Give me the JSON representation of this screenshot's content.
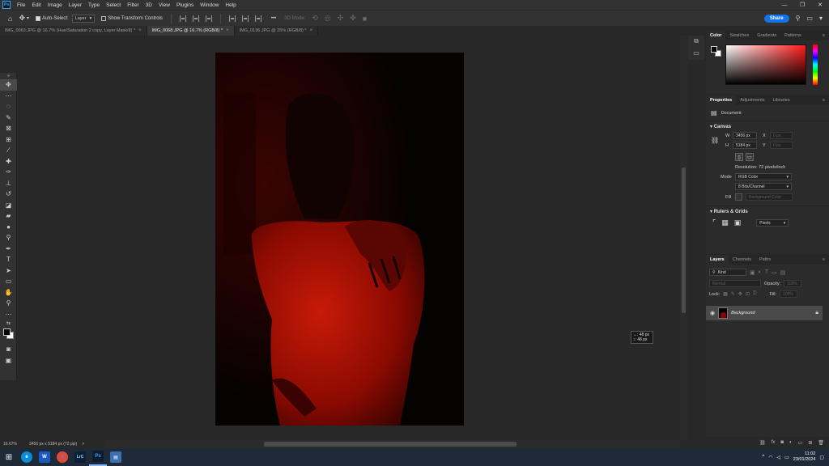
{
  "app": {
    "logo": "Ps"
  },
  "menu": [
    "File",
    "Edit",
    "Image",
    "Layer",
    "Type",
    "Select",
    "Filter",
    "3D",
    "View",
    "Plugins",
    "Window",
    "Help"
  ],
  "window_controls": {
    "minimize": "—",
    "restore": "❐",
    "close": "✕"
  },
  "options": {
    "auto_select_label": "Auto-Select:",
    "auto_select_value": "Layer",
    "transform_label": "Show Transform Controls",
    "mode_3d": "3D Mode:",
    "more": "•••",
    "share": "Share"
  },
  "tabs": [
    {
      "label": "IMG_0063.JPG @ 16.7% (Hue/Saturation 2 copy, Layer Mask/8) *",
      "active": false
    },
    {
      "label": "IMG_0068.JPG @ 16.7% (RGB/8) *",
      "active": true
    },
    {
      "label": "IMG_0136.JPG @ 25% (RGB/8) *",
      "active": false
    }
  ],
  "canvas": {
    "ruler_tooltip": {
      "line1": "↔: 48 px",
      "line2": "↕: 48 px"
    }
  },
  "status": {
    "zoom": "16.67%",
    "info": "3456 px x 5184 px (72 ppi)",
    "arrow": ">"
  },
  "color_panel": {
    "tabs": [
      "Color",
      "Swatches",
      "Gradients",
      "Patterns"
    ]
  },
  "properties": {
    "tabs": [
      "Properties",
      "Adjustments",
      "Libraries"
    ],
    "doc_label": "Document",
    "canvas_head": "Canvas",
    "w_label": "W",
    "w_value": "3456 px",
    "h_label": "H",
    "h_value": "5184 px",
    "x_label": "X",
    "x_value": "0 px",
    "y_label": "Y",
    "y_value": "0 px",
    "resolution": "Resolution: 72 pixels/inch",
    "mode_label": "Mode",
    "mode_value": "RGB Color",
    "bits_value": "8 Bits/Channel",
    "fill_label": "Fill",
    "fill_value": "Background Color",
    "rulers_head": "Rulers & Grids",
    "units_value": "Pixels"
  },
  "layers": {
    "tabs": [
      "Layers",
      "Channels",
      "Paths"
    ],
    "kind": "Kind",
    "blend": "Normal",
    "opacity_label": "Opacity:",
    "opacity_value": "100%",
    "lock_label": "Lock:",
    "fill_label": "Fill:",
    "fill_value": "100%",
    "layer_name": "Background"
  },
  "taskbar": {
    "apps": [
      {
        "name": "edge",
        "glyph": "e",
        "color": "#0c8bd8"
      },
      {
        "name": "word",
        "glyph": "W",
        "color": "#185abd"
      },
      {
        "name": "chrome",
        "glyph": "●",
        "color": "#dd4b39"
      },
      {
        "name": "lightroom",
        "glyph": "LrC",
        "color": "#0b2137"
      },
      {
        "name": "photoshop",
        "glyph": "Ps",
        "color": "#0f1b2e"
      },
      {
        "name": "notepad",
        "glyph": "▤",
        "color": "#3b6fb0"
      }
    ],
    "time": "11:02",
    "date": "23/01/2024"
  },
  "colors": {
    "accent": "#1473e6",
    "ps_blue": "#31a8ff",
    "photo_red": "#c21406"
  }
}
